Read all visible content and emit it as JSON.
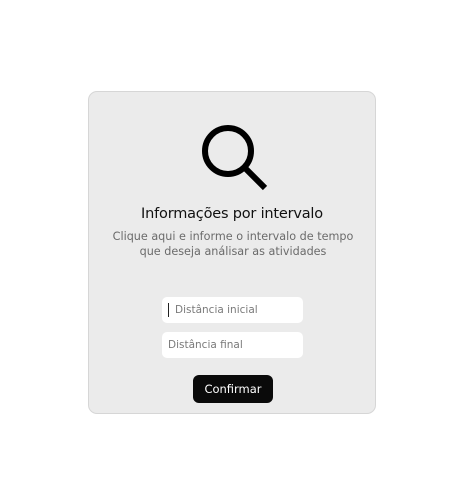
{
  "panel": {
    "icon": "search-icon",
    "title": "Informações por intervalo",
    "subtitle": "Clique aqui e informe o intervalo de tempo que deseja análisar as atividades"
  },
  "form": {
    "start_placeholder": "Distância inicial",
    "start_value": "",
    "end_placeholder": "Distância final",
    "end_value": "",
    "confirm_label": "Confirmar"
  },
  "colors": {
    "card_background": "#ebebeb",
    "button_background": "#0a0a0a",
    "button_text": "#ffffff"
  }
}
